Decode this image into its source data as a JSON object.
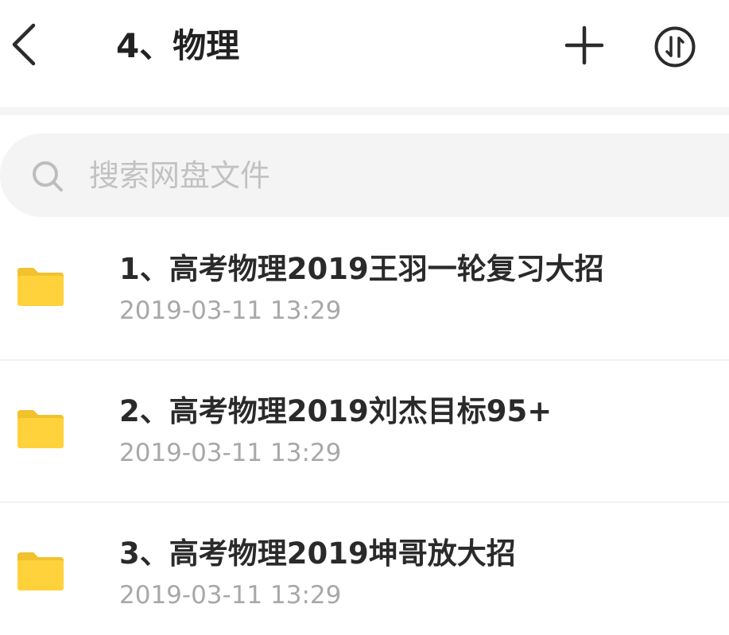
{
  "header": {
    "title": "4、物理",
    "back_icon": "chevron-left-icon",
    "add_icon": "plus-icon",
    "sort_icon": "sort-arrows-icon"
  },
  "search": {
    "placeholder": "搜索网盘文件",
    "icon": "search-icon"
  },
  "files": [
    {
      "name": "1、高考物理2019王羽一轮复习大招",
      "date": "2019-03-11  13:29",
      "type": "folder"
    },
    {
      "name": "2、高考物理2019刘杰目标95+",
      "date": "2019-03-11  13:29",
      "type": "folder"
    },
    {
      "name": "3、高考物理2019坤哥放大招",
      "date": "2019-03-11  13:29",
      "type": "folder"
    }
  ],
  "colors": {
    "folder": "#FFD23C",
    "folder_tab": "#F2C12E",
    "title_text": "#222222",
    "secondary_text": "#A8A8A8",
    "search_bg": "#F4F4F4"
  }
}
